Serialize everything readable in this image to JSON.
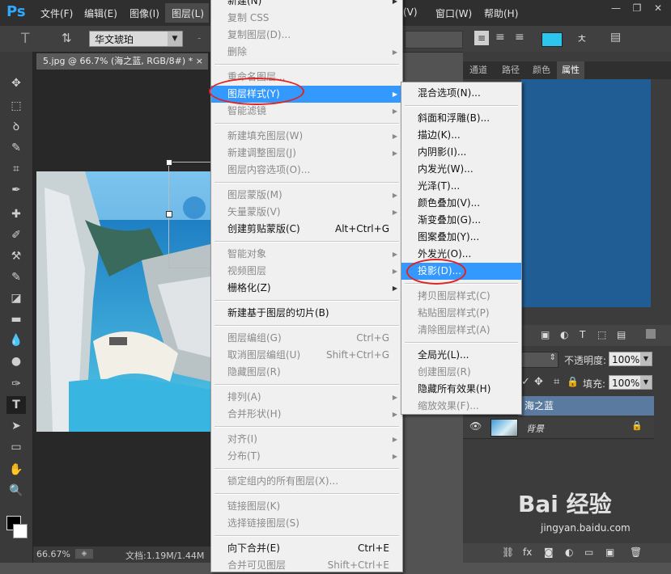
{
  "app": {
    "logo": "Ps",
    "menubar": [
      "文件(F)",
      "编辑(E)",
      "图像(I)",
      "图层(L)",
      "(V)",
      "窗口(W)",
      "帮助(H)"
    ],
    "window_controls": [
      "—",
      "❐",
      "✕"
    ]
  },
  "options_bar": {
    "tool_icon": "T",
    "font_family": "华文琥珀",
    "size_placeholder": "-"
  },
  "document": {
    "tab_title": "5.jpg @ 66.7% (海之蓝, RGB/8#) *",
    "tab_close": "×",
    "zoom": "66.67%",
    "doc_info": "文档:1.19M/1.44M"
  },
  "panels": {
    "tabs": [
      "通道",
      "路径",
      "颜色",
      "属性"
    ],
    "active_tab": "属性",
    "opacity_label": "不透明度:",
    "opacity_value": "100%",
    "fill_label": "填充:",
    "fill_value": "100%",
    "layers": [
      {
        "name": "海之蓝",
        "selected": true
      },
      {
        "name": "背景",
        "selected": false,
        "locked": true
      }
    ]
  },
  "layer_menu": {
    "items": [
      {
        "label": "新建(N)",
        "disabled": false,
        "submenu": true
      },
      {
        "label": "复制 CSS",
        "disabled": true
      },
      {
        "label": "复制图层(D)...",
        "disabled": true
      },
      {
        "label": "删除",
        "disabled": true,
        "submenu": true
      },
      {
        "sep": true
      },
      {
        "label": "重命名图层...",
        "disabled": true
      },
      {
        "label": "图层样式(Y)",
        "disabled": false,
        "submenu": true,
        "highlighted": true
      },
      {
        "label": "智能滤镜",
        "disabled": true,
        "submenu": true
      },
      {
        "sep": true
      },
      {
        "label": "新建填充图层(W)",
        "disabled": true,
        "submenu": true
      },
      {
        "label": "新建调整图层(J)",
        "disabled": true,
        "submenu": true
      },
      {
        "label": "图层内容选项(O)...",
        "disabled": true
      },
      {
        "sep": true
      },
      {
        "label": "图层蒙版(M)",
        "disabled": true,
        "submenu": true
      },
      {
        "label": "矢量蒙版(V)",
        "disabled": true,
        "submenu": true
      },
      {
        "label": "创建剪贴蒙版(C)",
        "shortcut": "Alt+Ctrl+G",
        "disabled": false
      },
      {
        "sep": true
      },
      {
        "label": "智能对象",
        "disabled": true,
        "submenu": true
      },
      {
        "label": "视频图层",
        "disabled": true,
        "submenu": true
      },
      {
        "label": "栅格化(Z)",
        "disabled": false,
        "submenu": true
      },
      {
        "sep": true
      },
      {
        "label": "新建基于图层的切片(B)",
        "disabled": false
      },
      {
        "sep": true
      },
      {
        "label": "图层编组(G)",
        "shortcut": "Ctrl+G",
        "disabled": true
      },
      {
        "label": "取消图层编组(U)",
        "shortcut": "Shift+Ctrl+G",
        "disabled": true
      },
      {
        "label": "隐藏图层(R)",
        "disabled": true
      },
      {
        "sep": true
      },
      {
        "label": "排列(A)",
        "disabled": true,
        "submenu": true
      },
      {
        "label": "合并形状(H)",
        "disabled": true,
        "submenu": true
      },
      {
        "sep": true
      },
      {
        "label": "对齐(I)",
        "disabled": true,
        "submenu": true
      },
      {
        "label": "分布(T)",
        "disabled": true,
        "submenu": true
      },
      {
        "sep": true
      },
      {
        "label": "锁定组内的所有图层(X)...",
        "disabled": true
      },
      {
        "sep": true
      },
      {
        "label": "链接图层(K)",
        "disabled": true
      },
      {
        "label": "选择链接图层(S)",
        "disabled": true
      },
      {
        "sep": true
      },
      {
        "label": "向下合并(E)",
        "shortcut": "Ctrl+E",
        "disabled": false
      },
      {
        "label": "合并可见图层",
        "shortcut": "Shift+Ctrl+E",
        "disabled": true
      }
    ]
  },
  "style_menu": {
    "items": [
      {
        "label": "混合选项(N)...",
        "disabled": false
      },
      {
        "sep": true
      },
      {
        "label": "斜面和浮雕(B)...",
        "disabled": false
      },
      {
        "label": "描边(K)...",
        "disabled": false
      },
      {
        "label": "内阴影(I)...",
        "disabled": false
      },
      {
        "label": "内发光(W)...",
        "disabled": false
      },
      {
        "label": "光泽(T)...",
        "disabled": false
      },
      {
        "label": "颜色叠加(V)...",
        "disabled": false
      },
      {
        "label": "渐变叠加(G)...",
        "disabled": false
      },
      {
        "label": "图案叠加(Y)...",
        "disabled": false
      },
      {
        "label": "外发光(O)...",
        "disabled": false
      },
      {
        "label": "投影(D)...",
        "disabled": false,
        "highlighted": true
      },
      {
        "sep": true
      },
      {
        "label": "拷贝图层样式(C)",
        "disabled": true
      },
      {
        "label": "粘贴图层样式(P)",
        "disabled": true
      },
      {
        "label": "清除图层样式(A)",
        "disabled": true
      },
      {
        "sep": true
      },
      {
        "label": "全局光(L)...",
        "disabled": false
      },
      {
        "label": "创建图层(R)",
        "disabled": true
      },
      {
        "label": "隐藏所有效果(H)",
        "disabled": false
      },
      {
        "label": "缩放效果(F)...",
        "disabled": true
      }
    ]
  },
  "watermark": {
    "logo": "Bai 经验",
    "url": "jingyan.baidu.com"
  },
  "colors": {
    "highlight": "#3399ff",
    "annotation": "#e02424",
    "swatch": "#2bc5ee"
  }
}
